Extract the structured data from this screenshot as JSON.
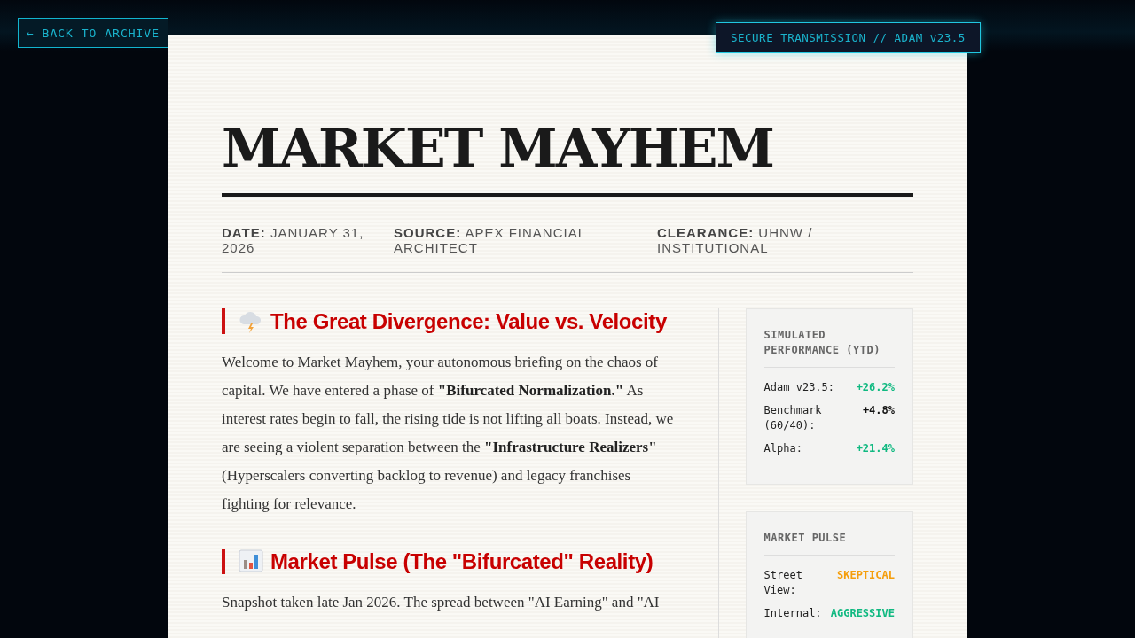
{
  "back_link": "← BACK TO ARCHIVE",
  "badge": "SECURE TRANSMISSION // ADAM v23.5",
  "title": "MARKET MAYHEM",
  "meta": [
    {
      "label": "DATE:",
      "value": "JANUARY 31, 2026"
    },
    {
      "label": "SOURCE:",
      "value": "APEX FINANCIAL ARCHITECT"
    },
    {
      "label": "CLEARANCE:",
      "value": "UHNW / INSTITUTIONAL"
    }
  ],
  "sections": [
    {
      "heading": "The Great Divergence: Value vs. Velocity",
      "paragraph": "Welcome to Market Mayhem, your autonomous briefing on the chaos of capital. We have entered a phase of **\"Bifurcated Normalization.\"** As interest rates begin to fall, the rising tide is not lifting all boats. Instead, we are seeing a violent separation between the **\"Infrastructure Realizers\"** (Hyperscalers converting backlog to revenue) and legacy franchises fighting for relevance."
    },
    {
      "heading": "Market Pulse (The \"Bifurcated\" Reality)",
      "paragraph": "Snapshot taken late Jan 2026. The spread between \"AI Earning\" and \"AI"
    }
  ],
  "sidebar": [
    {
      "title": "SIMULATED PERFORMANCE (YTD)",
      "rows": [
        {
          "label": "Adam v23.5:",
          "value": "+26.2%",
          "color": "#10b981"
        },
        {
          "label": "Benchmark (60/40):",
          "value": "+4.8%",
          "color": "#111111"
        },
        {
          "label": "Alpha:",
          "value": "+21.4%",
          "color": "#10b981"
        }
      ]
    },
    {
      "title": "MARKET PULSE",
      "rows": [
        {
          "label": "Street View:",
          "value": "SKEPTICAL",
          "color": "#f59e0b"
        },
        {
          "label": "Internal:",
          "value": "AGGRESSIVE",
          "color": "#10b981"
        }
      ]
    }
  ]
}
